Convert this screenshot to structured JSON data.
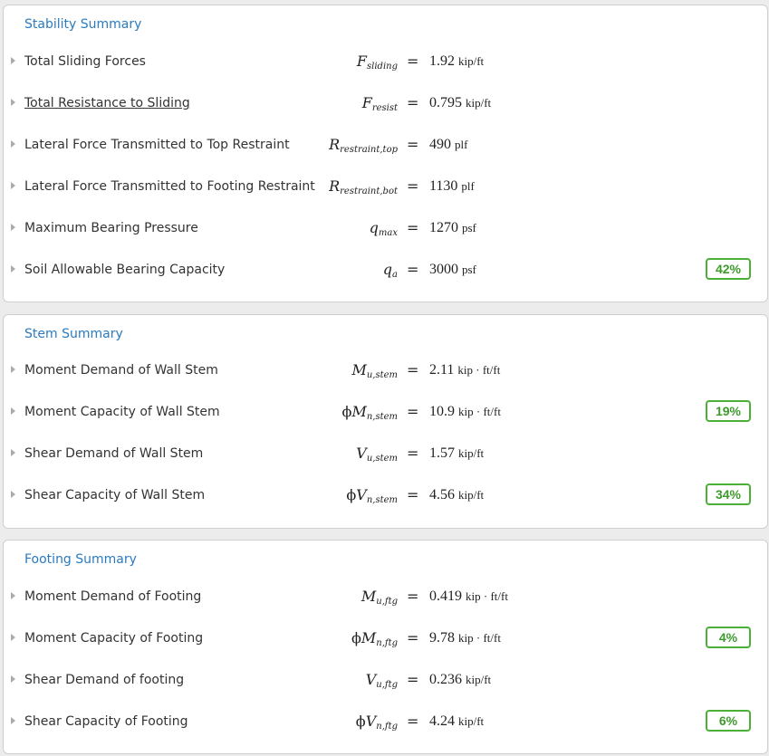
{
  "stability": {
    "title": "Stability Summary",
    "rows": [
      {
        "label": "Total Sliding Forces",
        "sym": "F",
        "sub": "sliding",
        "value": "1.92",
        "unit": "kip/ft",
        "badge": ""
      },
      {
        "label": "Total Resistance to Sliding",
        "sym": "F",
        "sub": "resist",
        "value": "0.795",
        "unit": "kip/ft",
        "badge": ""
      },
      {
        "label": "Lateral Force Transmitted to Top Restraint",
        "sym": "R",
        "sub": "restraint,top",
        "value": "490",
        "unit": "plf",
        "badge": ""
      },
      {
        "label": "Lateral Force Transmitted to Footing Restraint",
        "sym": "R",
        "sub": "restraint,bot",
        "value": "1130",
        "unit": "plf",
        "badge": ""
      },
      {
        "label": "Maximum Bearing Pressure",
        "sym": "q",
        "sub": "max",
        "value": "1270",
        "unit": "psf",
        "badge": ""
      },
      {
        "label": "Soil Allowable Bearing Capacity",
        "sym": "q",
        "sub": "a",
        "value": "3000",
        "unit": "psf",
        "badge": "42%"
      }
    ]
  },
  "stem": {
    "title": "Stem Summary",
    "rows": [
      {
        "label": "Moment Demand of Wall Stem",
        "sym": "M",
        "sub": "u,stem",
        "value": "2.11",
        "unit": "kip · ft/ft",
        "badge": ""
      },
      {
        "label": "Moment Capacity of Wall Stem",
        "phi": "ϕ",
        "sym": "M",
        "sub": "n,stem",
        "value": "10.9",
        "unit": "kip · ft/ft",
        "badge": "19%"
      },
      {
        "label": "Shear Demand of Wall Stem",
        "sym": "V",
        "sub": "u,stem",
        "value": "1.57",
        "unit": "kip/ft",
        "badge": ""
      },
      {
        "label": "Shear Capacity of Wall Stem",
        "phi": "ϕ",
        "sym": "V",
        "sub": "n,stem",
        "value": "4.56",
        "unit": "kip/ft",
        "badge": "34%"
      }
    ]
  },
  "footing": {
    "title": "Footing Summary",
    "rows": [
      {
        "label": "Moment Demand of Footing",
        "sym": "M",
        "sub": "u,ftg",
        "value": "0.419",
        "unit": "kip · ft/ft",
        "badge": ""
      },
      {
        "label": "Moment Capacity of Footing",
        "phi": "ϕ",
        "sym": "M",
        "sub": "n,ftg",
        "value": "9.78",
        "unit": "kip · ft/ft",
        "badge": "4%"
      },
      {
        "label": "Shear Demand of footing",
        "sym": "V",
        "sub": "u,ftg",
        "value": "0.236",
        "unit": "kip/ft",
        "badge": ""
      },
      {
        "label": "Shear Capacity of Footing",
        "phi": "ϕ",
        "sym": "V",
        "sub": "n,ftg",
        "value": "4.24",
        "unit": "kip/ft",
        "badge": "6%"
      }
    ]
  },
  "equals_sign": "=",
  "colors": {
    "accent": "#2a7bbf",
    "pass": "#4caf38"
  }
}
